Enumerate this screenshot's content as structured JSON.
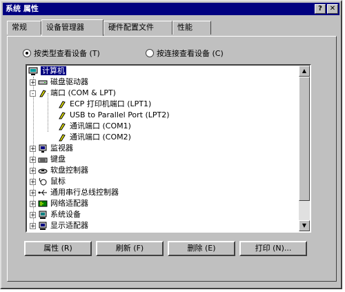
{
  "window": {
    "title": "系统 属性",
    "help_label": "?",
    "close_label": "✕"
  },
  "tabs": [
    {
      "label": "常规"
    },
    {
      "label": "设备管理器"
    },
    {
      "label": "硬件配置文件"
    },
    {
      "label": "性能"
    }
  ],
  "view": {
    "by_type": "按类型查看设备 (T)",
    "by_connection": "按连接查看设备 (C)",
    "selected": "by_type"
  },
  "tree": {
    "root": "计算机",
    "items": [
      {
        "label": "磁盘驱动器",
        "expander": "+",
        "icon": "disk-drive-icon"
      },
      {
        "label": "端口 (COM & LPT)",
        "expander": "-",
        "icon": "port-icon"
      },
      {
        "label": "ECP 打印机端口 (LPT1)",
        "icon": "port-icon",
        "child": true
      },
      {
        "label": "USB to Parallel Port (LPT2)",
        "icon": "port-icon",
        "child": true
      },
      {
        "label": "通讯端口 (COM1)",
        "icon": "port-icon",
        "child": true
      },
      {
        "label": "通讯端口 (COM2)",
        "icon": "port-icon",
        "child": true
      },
      {
        "label": "监视器",
        "expander": "+",
        "icon": "monitor-icon"
      },
      {
        "label": "键盘",
        "expander": "+",
        "icon": "keyboard-icon"
      },
      {
        "label": "软盘控制器",
        "expander": "+",
        "icon": "floppy-controller-icon"
      },
      {
        "label": "鼠标",
        "expander": "+",
        "icon": "mouse-icon"
      },
      {
        "label": "通用串行总线控制器",
        "expander": "+",
        "icon": "usb-icon"
      },
      {
        "label": "网络适配器",
        "expander": "+",
        "icon": "network-adapter-icon"
      },
      {
        "label": "系统设备",
        "expander": "+",
        "icon": "system-device-icon"
      },
      {
        "label": "显示适配器",
        "expander": "+",
        "icon": "display-adapter-icon"
      }
    ]
  },
  "buttons": {
    "properties": "属性 (R)",
    "refresh": "刷新 (F)",
    "remove": "删除 (E)",
    "print": "打印 (N)..."
  },
  "colors": {
    "title_bar": "#000080",
    "face": "#c0c0c0",
    "selection": "#000080"
  }
}
